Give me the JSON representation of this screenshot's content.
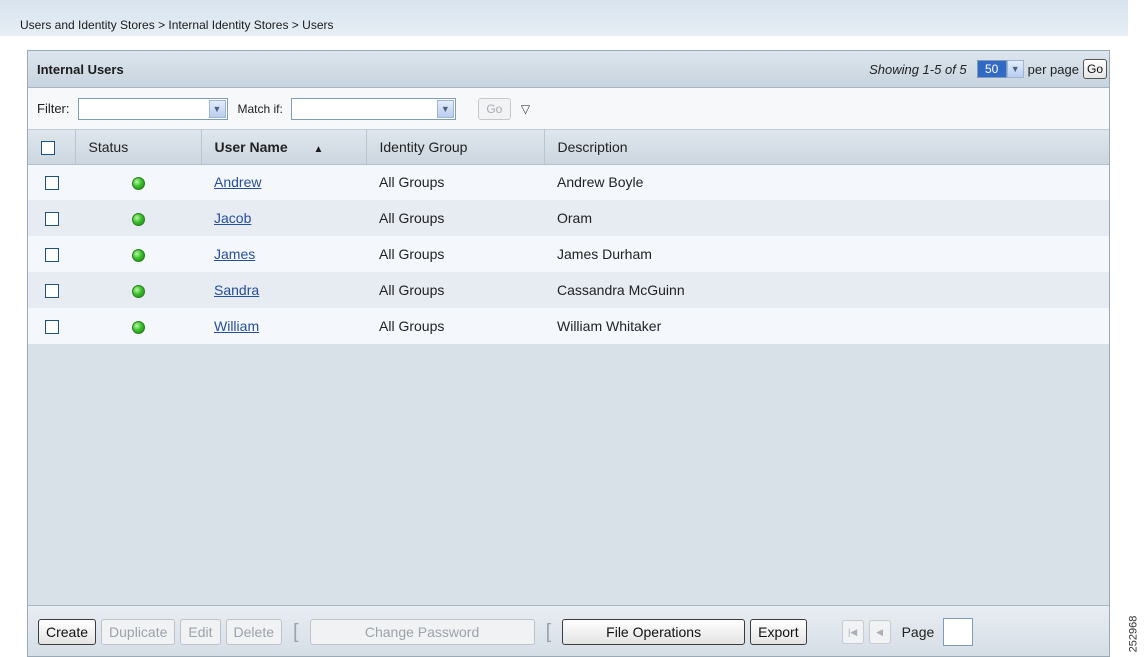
{
  "breadcrumb": "Users and Identity Stores > Internal Identity Stores > Users",
  "panel": {
    "title": "Internal Users",
    "showing": "Showing 1-5 of 5",
    "per_page_value": "50",
    "per_page_label": "per page",
    "go_label": "Go"
  },
  "filter": {
    "filter_label": "Filter:",
    "match_label": "Match if:",
    "go_label": "Go"
  },
  "table": {
    "headers": {
      "status": "Status",
      "user_name": "User Name",
      "identity_group": "Identity Group",
      "description": "Description"
    },
    "sorted_column": "user_name",
    "sort_direction": "ascending",
    "rows": [
      {
        "status": "enabled",
        "user_name": "Andrew",
        "identity_group": "All Groups",
        "description": "Andrew Boyle"
      },
      {
        "status": "enabled",
        "user_name": "Jacob",
        "identity_group": "All Groups",
        "description": "Oram"
      },
      {
        "status": "enabled",
        "user_name": "James",
        "identity_group": "All Groups",
        "description": "James Durham"
      },
      {
        "status": "enabled",
        "user_name": "Sandra",
        "identity_group": "All Groups",
        "description": "Cassandra McGuinn"
      },
      {
        "status": "enabled",
        "user_name": "William",
        "identity_group": "All Groups",
        "description": "William Whitaker"
      }
    ]
  },
  "footer": {
    "create": "Create",
    "duplicate": "Duplicate",
    "edit": "Edit",
    "delete": "Delete",
    "change_password": "Change Password",
    "file_operations": "File Operations",
    "export": "Export",
    "page_label": "Page"
  },
  "figure_id": "252968",
  "colors": {
    "status_enabled": "#39c22b",
    "link": "#274e9b",
    "selected_highlight": "#316ac5"
  },
  "icons": {
    "status": "status-enabled-icon",
    "sort": "sort-ascending-icon",
    "dropdown": "chevron-down-icon",
    "filter_toggle": "triangle-down-icon",
    "first_page": "first-page-icon",
    "prev_page": "previous-page-icon"
  }
}
